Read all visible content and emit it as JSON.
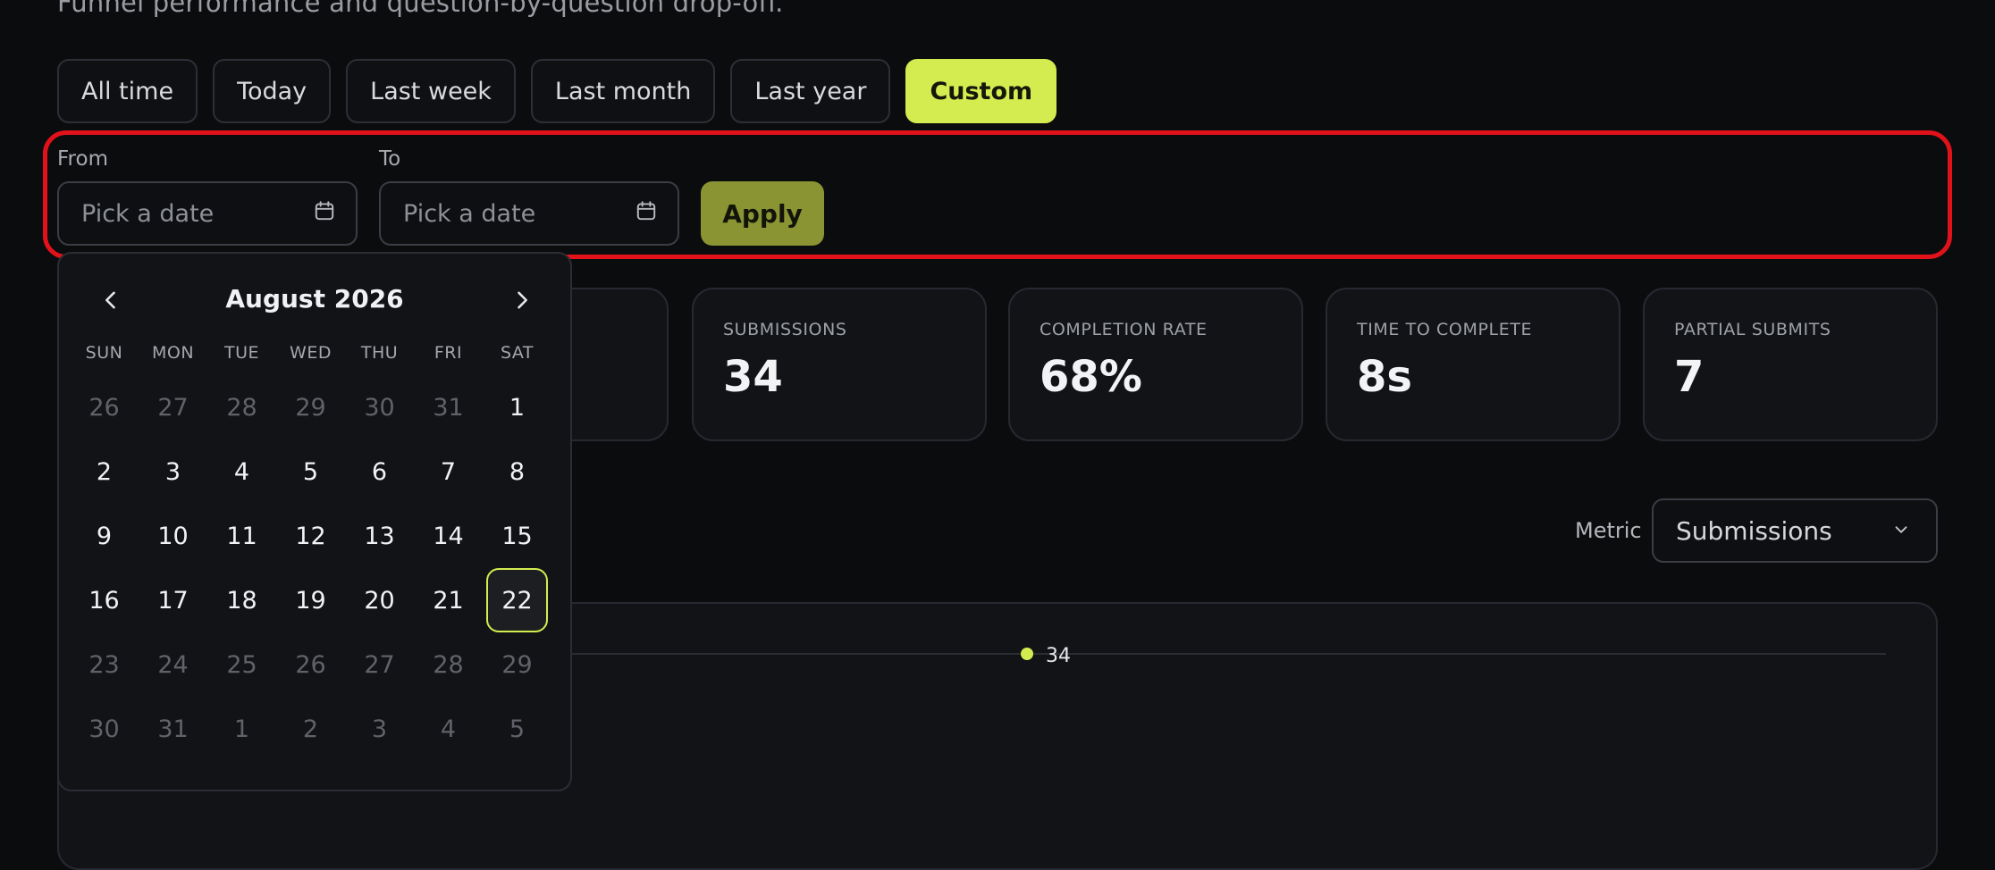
{
  "page": {
    "subtitle": "Funnel performance and question-by-question drop-off."
  },
  "ranges": [
    {
      "label": "All time",
      "active": false
    },
    {
      "label": "Today",
      "active": false
    },
    {
      "label": "Last week",
      "active": false
    },
    {
      "label": "Last month",
      "active": false
    },
    {
      "label": "Last year",
      "active": false
    },
    {
      "label": "Custom",
      "active": true
    }
  ],
  "date_filter": {
    "from_label": "From",
    "to_label": "To",
    "from_placeholder": "Pick a date",
    "to_placeholder": "Pick a date",
    "apply_label": "Apply"
  },
  "stats": [
    {
      "label": "SUBMISSIONS",
      "value": "34"
    },
    {
      "label": "COMPLETION RATE",
      "value": "68%"
    },
    {
      "label": "TIME TO COMPLETE",
      "value": "8s"
    },
    {
      "label": "PARTIAL SUBMITS",
      "value": "7"
    }
  ],
  "metric": {
    "label": "Metric",
    "selected": "Submissions"
  },
  "calendar": {
    "month_label": "August 2026",
    "weekdays": [
      "SUN",
      "MON",
      "TUE",
      "WED",
      "THU",
      "FRI",
      "SAT"
    ],
    "days": [
      {
        "d": "26",
        "muted": true
      },
      {
        "d": "27",
        "muted": true
      },
      {
        "d": "28",
        "muted": true
      },
      {
        "d": "29",
        "muted": true
      },
      {
        "d": "30",
        "muted": true
      },
      {
        "d": "31",
        "muted": true
      },
      {
        "d": "1",
        "muted": false
      },
      {
        "d": "2",
        "muted": false
      },
      {
        "d": "3",
        "muted": false
      },
      {
        "d": "4",
        "muted": false
      },
      {
        "d": "5",
        "muted": false
      },
      {
        "d": "6",
        "muted": false
      },
      {
        "d": "7",
        "muted": false
      },
      {
        "d": "8",
        "muted": false
      },
      {
        "d": "9",
        "muted": false
      },
      {
        "d": "10",
        "muted": false
      },
      {
        "d": "11",
        "muted": false
      },
      {
        "d": "12",
        "muted": false
      },
      {
        "d": "13",
        "muted": false
      },
      {
        "d": "14",
        "muted": false
      },
      {
        "d": "15",
        "muted": false
      },
      {
        "d": "16",
        "muted": false
      },
      {
        "d": "17",
        "muted": false
      },
      {
        "d": "18",
        "muted": false
      },
      {
        "d": "19",
        "muted": false
      },
      {
        "d": "20",
        "muted": false
      },
      {
        "d": "21",
        "muted": false
      },
      {
        "d": "22",
        "muted": false,
        "today": true
      },
      {
        "d": "23",
        "muted": true
      },
      {
        "d": "24",
        "muted": true
      },
      {
        "d": "25",
        "muted": true
      },
      {
        "d": "26",
        "muted": true
      },
      {
        "d": "27",
        "muted": true
      },
      {
        "d": "28",
        "muted": true
      },
      {
        "d": "29",
        "muted": true
      },
      {
        "d": "30",
        "muted": true
      },
      {
        "d": "31",
        "muted": true
      },
      {
        "d": "1",
        "muted": true
      },
      {
        "d": "2",
        "muted": true
      },
      {
        "d": "3",
        "muted": true
      },
      {
        "d": "4",
        "muted": true
      },
      {
        "d": "5",
        "muted": true
      }
    ]
  },
  "chart": {
    "point_label": "34"
  },
  "colors": {
    "accent": "#d4ec4f",
    "apply_bg": "#8a9433",
    "highlight_outline": "#e2121b"
  },
  "icons": {
    "date_input": "calendar-icon",
    "prev": "chevron-left-icon",
    "next": "chevron-right-icon",
    "select": "chevron-down-icon"
  }
}
